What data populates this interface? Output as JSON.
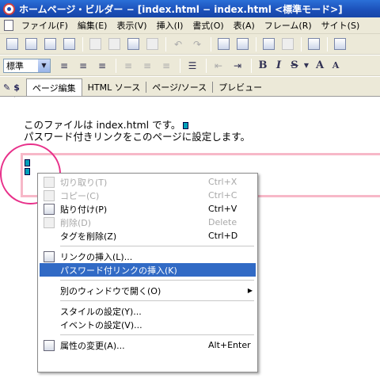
{
  "window": {
    "title": "ホームページ・ビルダー − [index.html − index.html <標準モード>]"
  },
  "menu": [
    "ファイル(F)",
    "編集(E)",
    "表示(V)",
    "挿入(I)",
    "書式(O)",
    "表(A)",
    "フレーム(R)",
    "サイト(S)"
  ],
  "toolbar2": {
    "style_value": "標準",
    "bold": "B",
    "italic": "I",
    "strike": "S",
    "font_size_up": "A",
    "font_size_down": "A"
  },
  "tabs": {
    "edit": "ページ編集",
    "html_source": "HTML ソース",
    "page_source": "ページ/ソース",
    "preview": "プレビュー"
  },
  "editor": {
    "line1": "このファイルは index.html です。",
    "line2": "パスワード付きリンクをこのページに設定します。"
  },
  "context_menu": {
    "cut": {
      "label": "切り取り(T)",
      "shortcut": "Ctrl+X"
    },
    "copy": {
      "label": "コピー(C)",
      "shortcut": "Ctrl+C"
    },
    "paste": {
      "label": "貼り付け(P)",
      "shortcut": "Ctrl+V"
    },
    "delete": {
      "label": "削除(D)",
      "shortcut": "Delete"
    },
    "delete_tag": {
      "label": "タグを削除(Z)",
      "shortcut": "Ctrl+D"
    },
    "insert_link": {
      "label": "リンクの挿入(L)..."
    },
    "insert_password_link": {
      "label": "パスワード付リンクの挿入(K)"
    },
    "open_window": {
      "label": "別のウィンドウで開く(O)"
    },
    "style_settings": {
      "label": "スタイルの設定(Y)..."
    },
    "event_settings": {
      "label": "イベントの設定(V)..."
    },
    "attributes": {
      "label": "属性の変更(A)...",
      "shortcut": "Alt+Enter"
    }
  }
}
